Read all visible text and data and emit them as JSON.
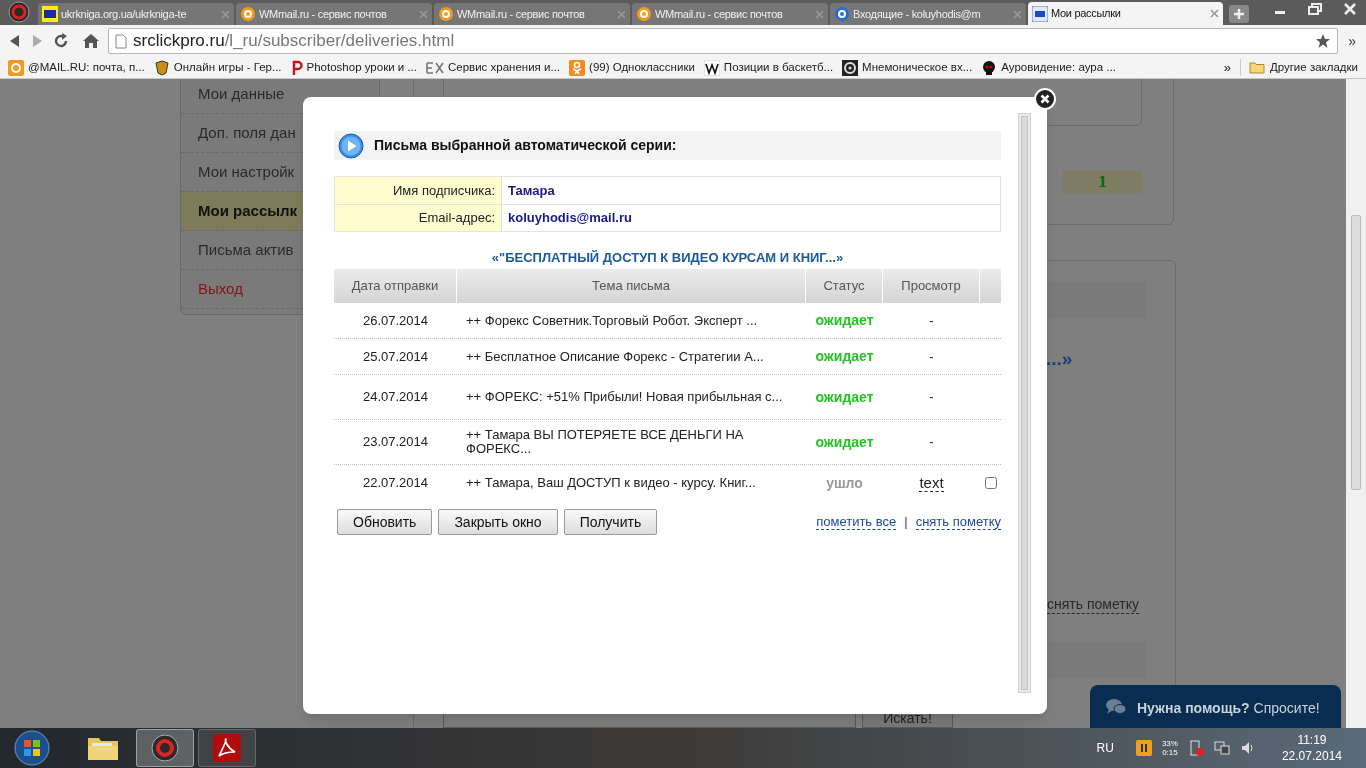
{
  "browser": {
    "tabs": [
      {
        "title": "ukrkniga.org.ua/ukrkniga-te",
        "selected": false
      },
      {
        "title": "WMmail.ru - сервис почтов",
        "selected": false
      },
      {
        "title": "WMmail.ru - сервис почтов",
        "selected": false
      },
      {
        "title": "WMmail.ru - сервис почтов",
        "selected": false
      },
      {
        "title": "Входящие - koluyhodis@m",
        "selected": false
      },
      {
        "title": "Мои рассылки",
        "selected": true
      }
    ],
    "address": {
      "host": "srclickpro.ru",
      "path": "/l_ru/subscriber/deliveries.html"
    },
    "bookmarks": [
      "@MAIL.RU: почта, п...",
      "Онлайн игры - Гер...",
      "Photoshop уроки и ...",
      "Сервис хранения и...",
      "(99) Одноклассники",
      "Позиции в баскетб...",
      "Мнемоническое вх...",
      "Ауровидение: аура ..."
    ],
    "bookmarks_more": "»",
    "other_bookmarks": "Другие закладки"
  },
  "page": {
    "sidebar": [
      {
        "label": "Мои данные",
        "selected": false,
        "kind": "link"
      },
      {
        "label": "Доп. поля дан",
        "selected": false,
        "kind": "link"
      },
      {
        "label": "Мои настройк",
        "selected": false,
        "kind": "link"
      },
      {
        "label": "Мои рассылк",
        "selected": true,
        "kind": "link"
      },
      {
        "label": "Письма актив",
        "selected": false,
        "kind": "link"
      },
      {
        "label": "Выход",
        "selected": false,
        "kind": "exit"
      }
    ],
    "counter": "1",
    "heading_fragment": "...»",
    "link": "снять пометку",
    "search_button": "Искать!"
  },
  "modal": {
    "title": "Письма выбранной автоматической серии:",
    "subscriber": [
      {
        "label": "Имя подписчика:",
        "value": "Тамара"
      },
      {
        "label": "Email-адрес:",
        "value": "koluyhodis@mail.ru"
      }
    ],
    "series_title": "«\"БЕСПЛАТНЫЙ ДОСТУП К ВИДЕО КУРСАМ И КНИГ...»",
    "columns": [
      "Дата отправки",
      "Тема письма",
      "Статус",
      "Просмотр"
    ],
    "rows": [
      {
        "date": "26.07.2014",
        "subject": "++ Форекс Советник.Торговый Робот. Эксперт ...",
        "status": "ожидает",
        "kind": "pending",
        "view": "-"
      },
      {
        "date": "25.07.2014",
        "subject": "++ Бесплатное Описание Форекс - Стратегии А...",
        "status": "ожидает",
        "kind": "pending",
        "view": "-"
      },
      {
        "date": "24.07.2014",
        "subject": "++ ФОРЕКС: +51% Прибыли! Новая прибыльная с...",
        "status": "ожидает",
        "kind": "pending",
        "view": "-"
      },
      {
        "date": "23.07.2014",
        "subject": "++ Тамара ВЫ ПОТЕРЯЕТЕ ВСЕ ДЕНЬГИ НА ФОРЕКС...",
        "status": "ожидает",
        "kind": "pending",
        "view": "-"
      },
      {
        "date": "22.07.2014",
        "subject": "++ Тамара, Ваш ДОСТУП к видео - курсу. Книг...",
        "status": "ушло",
        "kind": "sent",
        "view": "text",
        "checked": false
      }
    ],
    "buttons": [
      "Обновить",
      "Закрыть окно",
      "Получить"
    ],
    "links": [
      "пометить все",
      "снять пометку"
    ],
    "link_separator": "|"
  },
  "chat": {
    "text": "**Нужна помощь?** Спросите!"
  },
  "taskbar": {
    "language": "RU",
    "battery_percent": "33%",
    "battery_time": "0:15",
    "time": "11:19",
    "date": "22.07.2014"
  }
}
